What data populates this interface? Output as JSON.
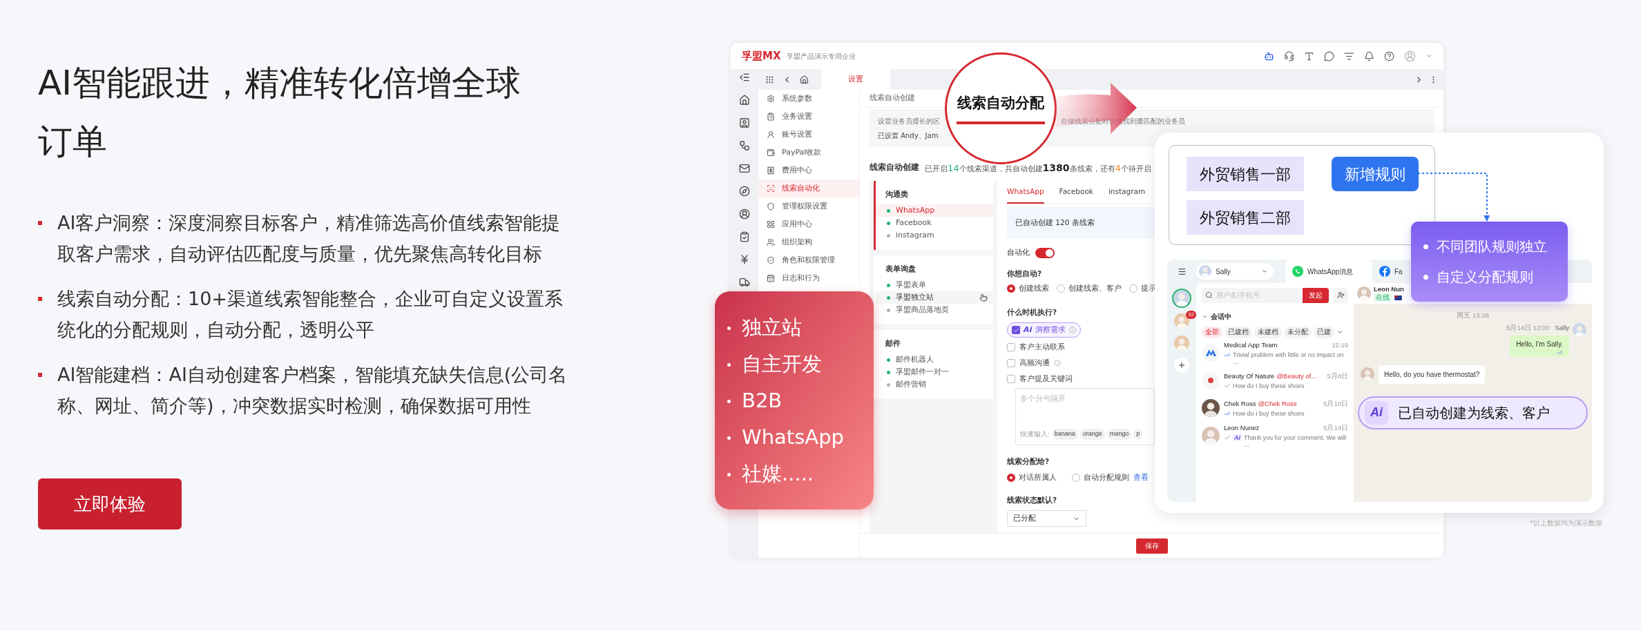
{
  "hero": {
    "title": "AI智能跟进，精准转化倍增全球订单",
    "bullets": [
      "AI客户洞察：深度洞察目标客户，精准筛选高价值线索智能提取客户需求，自动评估匹配度与质量，优先聚焦高转化目标",
      "线索自动分配：10+渠道线索智能整合，企业可自定义设置系统化的分配规则，自动分配，透明公平",
      "AI智能建档：AI自动创建客户档案，智能填充缺失信息(公司名称、网址、简介等)，冲突数据实时检测，确保数据可用性"
    ],
    "cta": "立即体验"
  },
  "app": {
    "brand": "孚盟MX",
    "company": "孚盟产品演示专用企业",
    "menu_tab": "设置",
    "menu": [
      {
        "label": "系统参数",
        "selected": false
      },
      {
        "label": "业务设置",
        "selected": false
      },
      {
        "label": "账号设置",
        "selected": false
      },
      {
        "label": "PayPal收款",
        "selected": false
      },
      {
        "label": "费用中心",
        "selected": false
      },
      {
        "label": "线索自动化",
        "selected": true
      },
      {
        "label": "管理权限设置",
        "selected": false
      },
      {
        "label": "应用中心",
        "selected": false
      },
      {
        "label": "组织架构",
        "selected": false
      },
      {
        "label": "角色和权限管理",
        "selected": false
      },
      {
        "label": "日志和行为",
        "selected": false
      }
    ],
    "page_title": "线索自动创建",
    "info": {
      "line1_start": "设置业务员擅长的区",
      "line1_end": "在做线索分配时快速找到最匹配的业务员",
      "line2": "已设置 Andy、Jam"
    },
    "stats": {
      "label": "线索自动创建",
      "segments": [
        {
          "text": "已开启",
          "kind": "plain"
        },
        {
          "text": "14",
          "kind": "green"
        },
        {
          "text": "个线索渠道，共自动创建",
          "kind": "plain"
        },
        {
          "text": "1380",
          "kind": "big"
        },
        {
          "text": "条线索，还有",
          "kind": "plain"
        },
        {
          "text": "4",
          "kind": "orange"
        },
        {
          "text": "个待开启",
          "kind": "plain"
        }
      ]
    },
    "channel_groups": [
      {
        "title": "沟通类",
        "selected": true,
        "items": [
          {
            "label": "WhatsApp",
            "selected": true,
            "enabled": true,
            "hovered": false
          },
          {
            "label": "Facebook",
            "selected": false,
            "enabled": true,
            "hovered": false
          },
          {
            "label": "instagram",
            "selected": false,
            "enabled": false,
            "hovered": false
          }
        ]
      },
      {
        "title": "表单询盘",
        "selected": false,
        "items": [
          {
            "label": "孚盟表单",
            "selected": false,
            "enabled": true,
            "hovered": false
          },
          {
            "label": "孚盟独立站",
            "selected": false,
            "enabled": true,
            "hovered": true
          },
          {
            "label": "孚盟商品落地页",
            "selected": false,
            "enabled": false,
            "hovered": false
          }
        ]
      },
      {
        "title": "邮件",
        "selected": false,
        "items": [
          {
            "label": "邮件机器人",
            "selected": false,
            "enabled": true,
            "hovered": false
          },
          {
            "label": "孚盟邮件一对一",
            "selected": false,
            "enabled": true,
            "hovered": false
          },
          {
            "label": "邮件营销",
            "selected": false,
            "enabled": false,
            "hovered": false
          }
        ]
      }
    ],
    "tabs": [
      {
        "label": "WhatsApp",
        "selected": true
      },
      {
        "label": "Facebook",
        "selected": false
      },
      {
        "label": "instagram",
        "selected": false
      }
    ],
    "created_note": "已自动创建 120 条线索",
    "automation": {
      "label": "自动化",
      "on": true
    },
    "action_question": "你想自动?",
    "action_options": [
      {
        "label": "创建线索",
        "selected": true
      },
      {
        "label": "创建线索、客户",
        "selected": false
      },
      {
        "label": "提示",
        "selected": false
      }
    ],
    "trigger_question": "什么时机执行?",
    "triggers": [
      {
        "kind": "ai",
        "badge": "Ai",
        "label": "洞察需求",
        "checked": true,
        "info": true
      },
      {
        "kind": "plain",
        "label": "客户主动联系",
        "checked": false,
        "info": false
      },
      {
        "kind": "plain",
        "label": "高频沟通",
        "checked": false,
        "info": true
      },
      {
        "kind": "plain",
        "label": "客户提及关键词",
        "checked": false,
        "info": false
      }
    ],
    "keywords": {
      "placeholder": "多个分号隔开",
      "quick_label": "快速输入:",
      "chips": [
        "banana",
        "orange",
        "mango",
        "p"
      ]
    },
    "assign_question": "线索分配给?",
    "assign_options": [
      {
        "label": "对话所属人",
        "selected": true
      },
      {
        "label": "自动分配规则",
        "selected": false
      }
    ],
    "assign_link": "查看",
    "status_question": "线索状态默认?",
    "status_value": "已分配",
    "save": "保存"
  },
  "callout": "线索自动分配",
  "promo": [
    "独立站",
    "自主开发",
    "B2B",
    "WhatsApp",
    "社媒....."
  ],
  "rules": {
    "teams": [
      "外贸销售一部",
      "外贸销售二部"
    ],
    "add": "新增规则"
  },
  "features": [
    "不同团队规则独立",
    "自定义分配规则"
  ],
  "chat": {
    "account": "Sally",
    "tabs": [
      {
        "label": "WhatsApp消息",
        "selected": true,
        "kind": "whatsapp"
      },
      {
        "label": "Fa",
        "selected": false,
        "kind": "facebook"
      }
    ],
    "unread": "32",
    "search_placeholder": "用户名/手机号",
    "start": "发起",
    "section": "会话中",
    "filters": [
      {
        "label": "全部",
        "selected": true
      },
      {
        "label": "已建档",
        "selected": false
      },
      {
        "label": "未建档",
        "selected": false
      },
      {
        "label": "未分配",
        "selected": false
      },
      {
        "label": "已建",
        "selected": false
      }
    ],
    "conversations": [
      {
        "kind": "team",
        "name": "Medical App Team",
        "time": "15:19",
        "read": true,
        "preview": "Trivial problem with little or no impact on ..."
      },
      {
        "kind": "brand",
        "name": "Beauty Of Nature",
        "mention": "@Beauty of...",
        "time": "5月8日",
        "read": false,
        "preview": "How do I buy these shoes"
      },
      {
        "kind": "person",
        "name": "Chek Ross",
        "mention": "@Chek Ross",
        "time": "5月10日",
        "read": true,
        "preview": "How do I buy these shoes"
      },
      {
        "kind": "person",
        "name": "Leon Nunez",
        "time": "5月14日",
        "read": false,
        "ai_badge": "Ai",
        "preview": "Thank you for your comment. We will ..."
      }
    ],
    "contact": {
      "name": "Leon Nun",
      "status": "在线"
    },
    "day": "周五 13:28",
    "messages": [
      {
        "kind": "out",
        "time": "5月14日 13:00",
        "sender": "Sally",
        "text": "Hello, I'm Sally.",
        "read": true
      },
      {
        "kind": "in",
        "text": "Hello, do you have thermostat?"
      }
    ],
    "ai_notice": {
      "badge": "Ai",
      "text": "已自动创建为线索、客户"
    }
  },
  "footnote": "*以上数据均为演示数据"
}
